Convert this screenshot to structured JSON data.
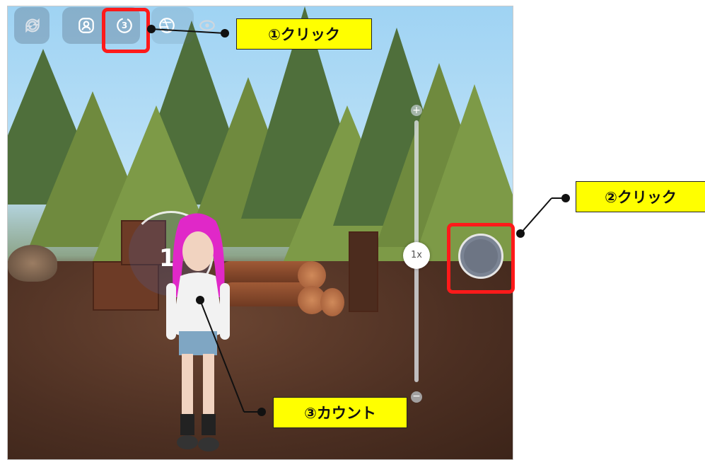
{
  "scene": {
    "zoom_label": "1x",
    "zoom_plus": "+",
    "zoom_minus": "−",
    "countdown_value": "1"
  },
  "toolbar": {
    "icons": [
      "rotate-camera-icon",
      "face-icon",
      "timer-3s-icon",
      "filter-icon",
      "visibility-icon"
    ],
    "timer_label": "3"
  },
  "callouts": {
    "step1": "①クリック",
    "step2": "②クリック",
    "step3": "③カウント"
  },
  "colors": {
    "highlight": "#ff1a1a",
    "callout_bg": "#ffff00"
  }
}
